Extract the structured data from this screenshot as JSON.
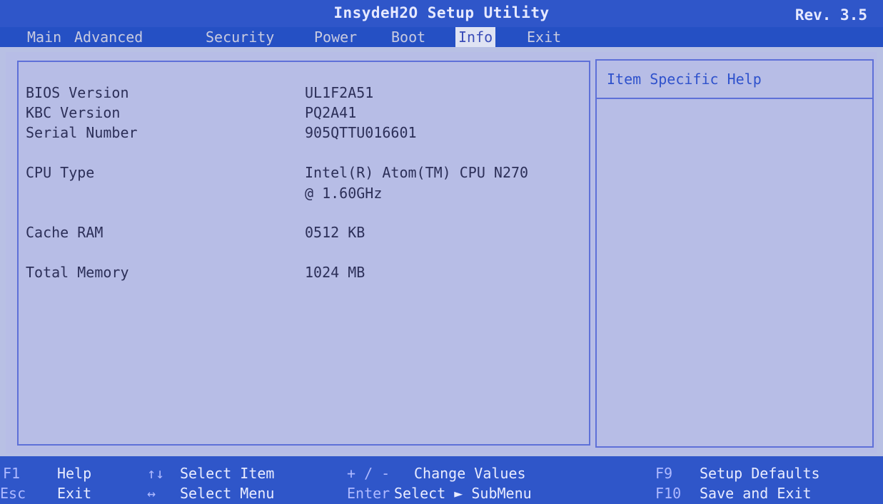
{
  "window": {
    "title": "InsydeH2O Setup Utility",
    "revision": "Rev. 3.5"
  },
  "menu": {
    "tabs": [
      "Main",
      "Advanced",
      "Security",
      "Power",
      "Boot",
      "Info",
      "Exit"
    ],
    "active": "Info"
  },
  "info": {
    "rows": [
      {
        "label": "BIOS Version",
        "value": "UL1F2A51"
      },
      {
        "label": "KBC Version",
        "value": "PQ2A41"
      },
      {
        "label": "Serial Number",
        "value": "905QTTU016601"
      },
      {
        "label": "CPU Type",
        "value_line1": "Intel(R) Atom(TM) CPU N270",
        "value_line2": "@ 1.60GHz"
      },
      {
        "label": "Cache RAM",
        "value": "0512 KB"
      },
      {
        "label": "Total Memory",
        "value": "1024 MB"
      }
    ]
  },
  "help": {
    "title": "Item Specific Help"
  },
  "footer": {
    "hints": [
      {
        "key": "F1",
        "text": "Help"
      },
      {
        "key": "↑↓",
        "text": "Select Item"
      },
      {
        "key": "+ / -",
        "text": "Change Values"
      },
      {
        "key": "F9",
        "text": "Setup Defaults"
      },
      {
        "key": "Esc",
        "text": "Exit"
      },
      {
        "key": "↔",
        "text": "Select Menu"
      },
      {
        "key": "Enter",
        "text": "Select ► SubMenu"
      },
      {
        "key": "F10",
        "text": "Save and Exit"
      }
    ]
  },
  "colors": {
    "background": "#b8c0e4",
    "header": "#2f56c9",
    "accent": "#2f52cc",
    "text": "#2c2f58"
  }
}
